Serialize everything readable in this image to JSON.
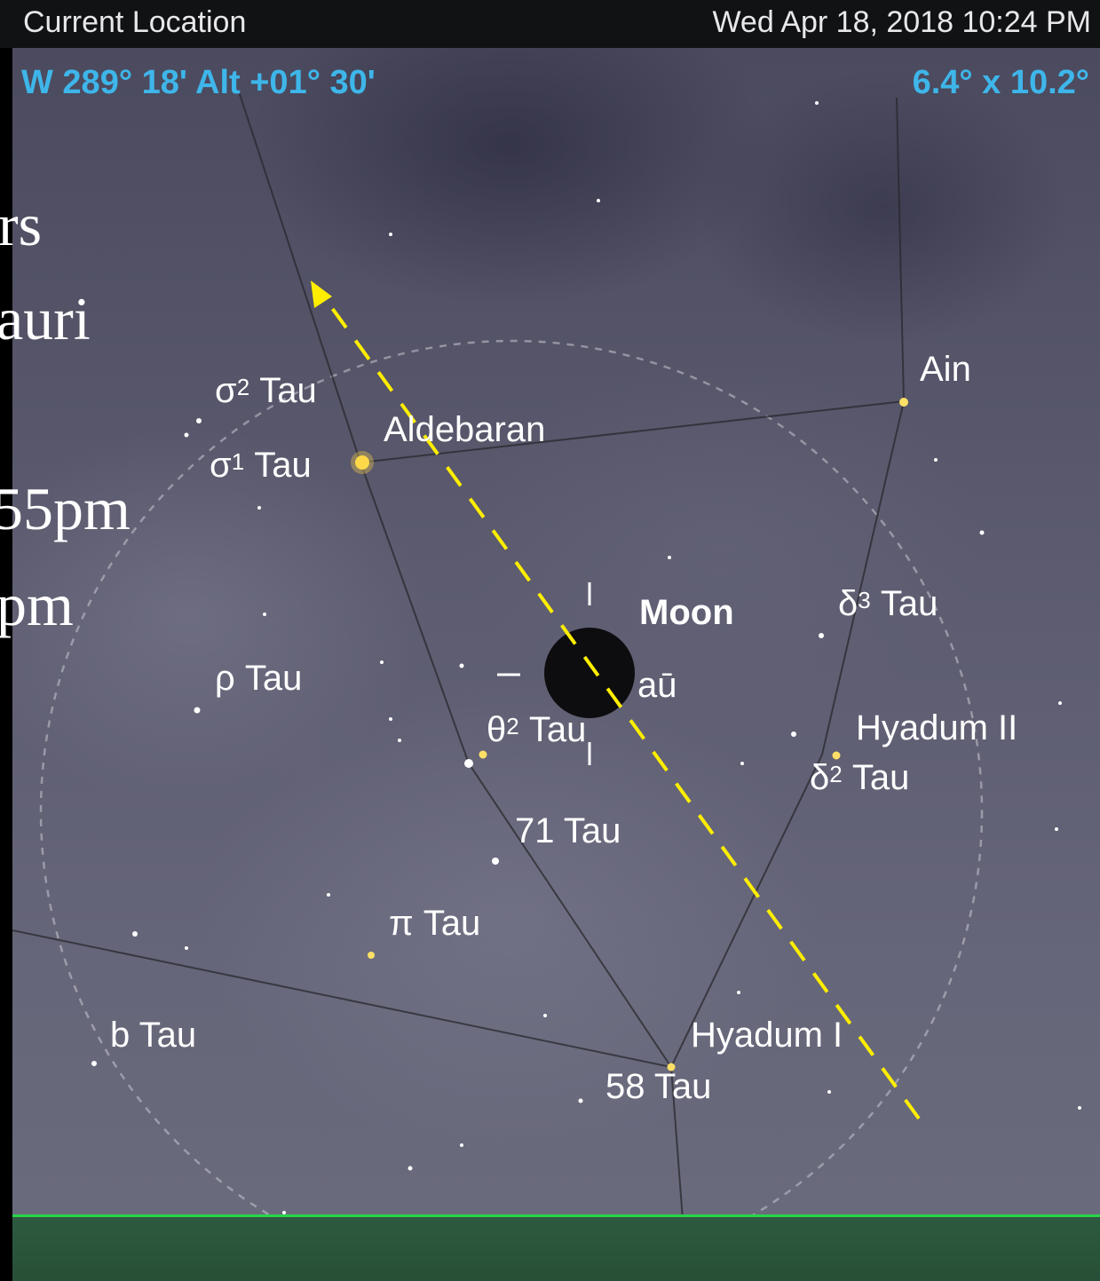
{
  "status_bar": {
    "location": "Current Location",
    "datetime": "Wed Apr 18, 2018  10:24 PM"
  },
  "readouts": {
    "position": "W 289° 18' Alt +01° 30'",
    "field_of_view": "6.4° x 10.2°"
  },
  "slide_text_fragments": [
    "rs",
    "auri",
    "55pm",
    "pm"
  ],
  "labels": {
    "sigma2": {
      "base": "σ",
      "sup": "2",
      "rest": " Tau"
    },
    "sigma1": {
      "base": "σ",
      "sup": "1",
      "rest": " Tau"
    },
    "aldebaran": "Aldebaran",
    "ain": "Ain",
    "moon": "Moon",
    "delta3": {
      "base": "δ",
      "sup": "3",
      "rest": " Tau"
    },
    "rho": "ρ Tau",
    "theta2": {
      "base": "θ",
      "sup": "2",
      "rest": " Tau"
    },
    "au": "aū",
    "hyadum2": "Hyadum II",
    "delta2": {
      "base": "δ",
      "sup": "2",
      "rest": " Tau"
    },
    "t71": "71 Tau",
    "pi": "π Tau",
    "b": "b Tau",
    "hyadum1": "Hyadum I",
    "t58": "58 Tau"
  },
  "colors": {
    "readout": "#3eb6ea",
    "horizon": "#28d54a",
    "arrow": "#ffee00",
    "star_bright": "#ffd84a"
  }
}
